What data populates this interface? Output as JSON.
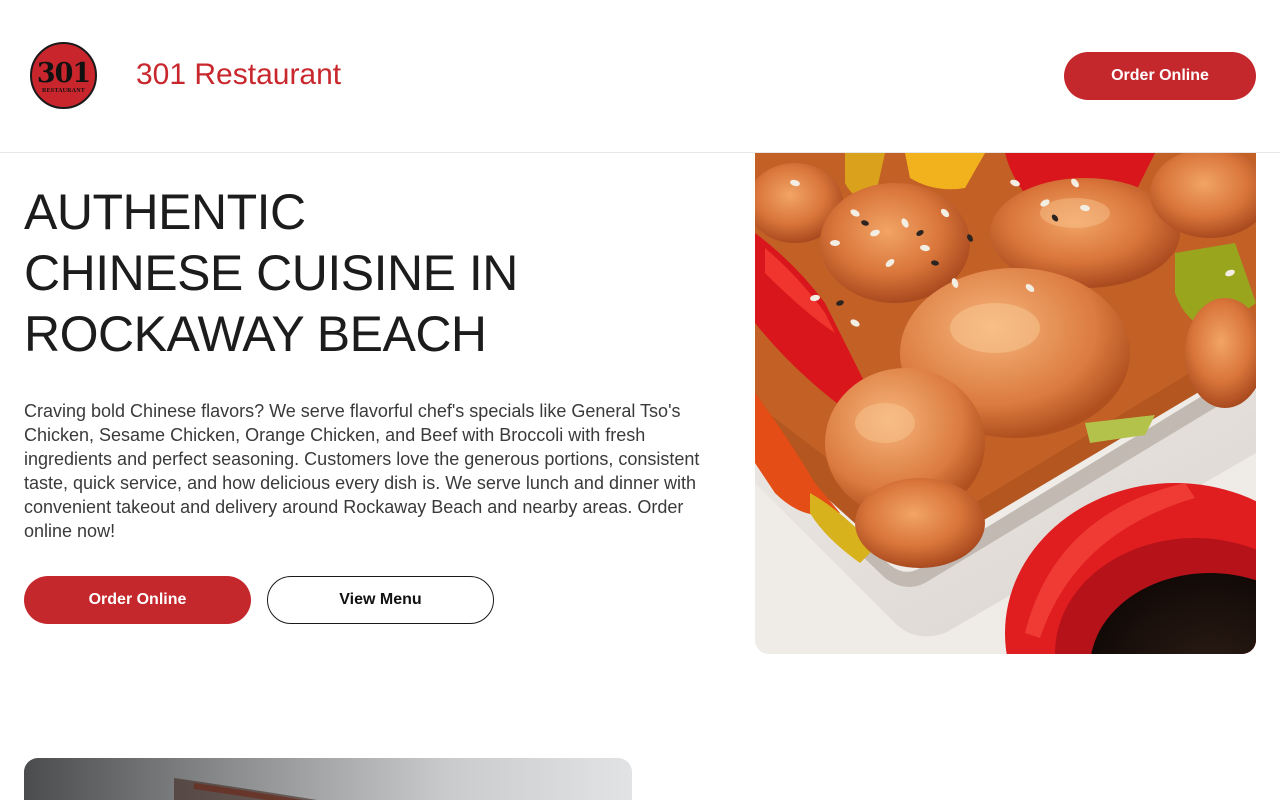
{
  "header": {
    "logo": {
      "number": "301",
      "subtext": "RESTAURANT"
    },
    "brand_name": "301 Restaurant",
    "order_button": "Order Online"
  },
  "hero": {
    "title_lines": [
      "AUTHENTIC",
      "CHINESE CUISINE IN",
      "ROCKAWAY BEACH"
    ],
    "description": "Craving bold Chinese flavors? We serve flavorful chef's specials like General Tso's Chicken, Sesame Chicken, Orange Chicken, and Beef with Broccoli with fresh ingredients and perfect seasoning. Customers love the generous portions, consistent taste, quick service, and how delicious every dish is. We serve lunch and dinner with convenient takeout and delivery around Rockaway Beach and nearby areas. Order online now!",
    "order_button": "Order Online",
    "menu_button": "View Menu"
  },
  "colors": {
    "brand_red": "#c4282d",
    "text_dark": "#1c1c1c",
    "border": "#e6e6e6"
  }
}
